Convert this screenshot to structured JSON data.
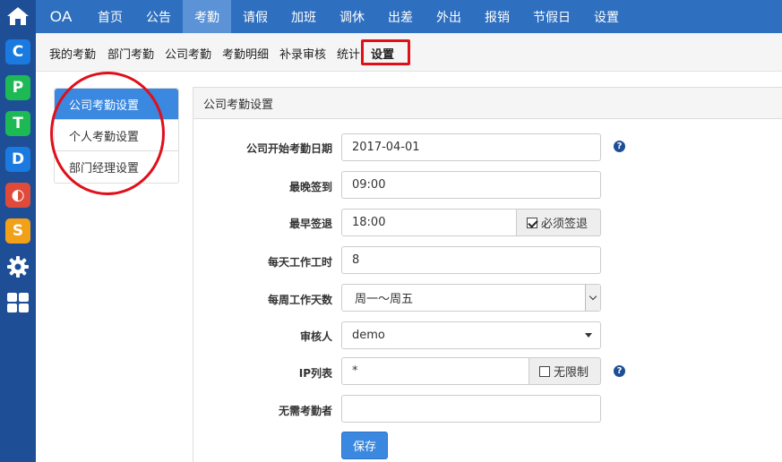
{
  "topnav": {
    "brand": "OA",
    "items": [
      "首页",
      "公告",
      "考勤",
      "请假",
      "加班",
      "调休",
      "出差",
      "外出",
      "报销",
      "节假日",
      "设置"
    ],
    "active_index": 2
  },
  "subnav": {
    "items": [
      "我的考勤",
      "部门考勤",
      "公司考勤",
      "考勤明细",
      "补录审核",
      "统计",
      "设置"
    ],
    "active_index": 6
  },
  "dock": {
    "icons": [
      "home-icon",
      "app-c-icon",
      "app-p-icon",
      "app-t-icon",
      "app-d-icon",
      "app-o-icon",
      "app-s-icon",
      "gear-icon",
      "grid-icon"
    ],
    "letters": {
      "c": "C",
      "p": "P",
      "t": "T",
      "d": "D",
      "o": "◐",
      "s": "S"
    }
  },
  "settings_menu": {
    "items": [
      "公司考勤设置",
      "个人考勤设置",
      "部门经理设置"
    ],
    "active_index": 0
  },
  "panel": {
    "title": "公司考勤设置"
  },
  "form": {
    "start_date": {
      "label": "公司开始考勤日期",
      "value": "2017-04-01"
    },
    "latest_checkin": {
      "label": "最晚签到",
      "value": "09:00"
    },
    "earliest_checkout": {
      "label": "最早签退",
      "value": "18:00",
      "addon": "必须签退",
      "addon_checked": true
    },
    "daily_hours": {
      "label": "每天工作工时",
      "value": "8"
    },
    "weekly_days": {
      "label": "每周工作天数",
      "value": "周一～周五"
    },
    "approver": {
      "label": "审核人",
      "value": "demo"
    },
    "ip_list": {
      "label": "IP列表",
      "value": "*",
      "addon": "无限制",
      "addon_checked": false
    },
    "exempt": {
      "label": "无需考勤者",
      "value": ""
    },
    "save_label": "保存"
  },
  "colors": {
    "dock_bg": "#1e4f96",
    "topnav_bg": "#2f6fbf",
    "topnav_active": "#5b93d6",
    "primary": "#3a88e0",
    "annotation_red": "#e0101a"
  }
}
